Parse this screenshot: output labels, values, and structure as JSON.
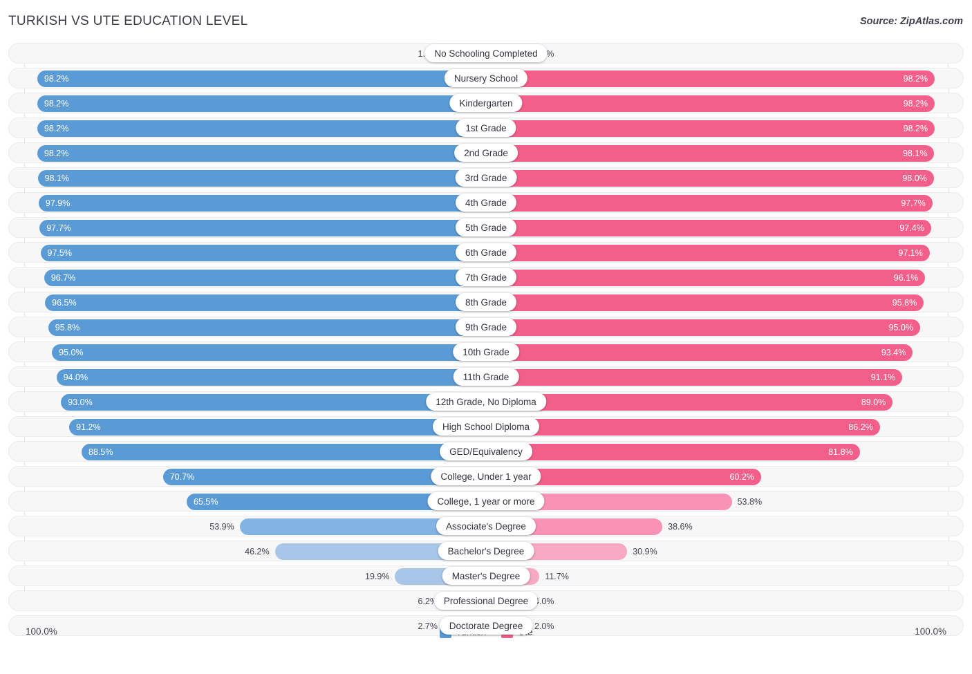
{
  "header": {
    "title": "TURKISH VS UTE EDUCATION LEVEL",
    "source": "Source: ZipAtlas.com"
  },
  "axis": {
    "left_max": "100.0%",
    "right_max": "100.0%"
  },
  "legend": {
    "items": [
      {
        "label": "Turkish",
        "color": "#5b9bd5"
      },
      {
        "label": "Ute",
        "color": "#f25f8a"
      }
    ]
  },
  "colors": {
    "blue_dark": "#5b9bd5",
    "blue_mid": "#82b3e3",
    "blue_light": "#a8c6e8",
    "pink_dark": "#f25f8a",
    "pink_mid": "#f893b5",
    "pink_light": "#f7a9c4",
    "row_bg": "#f7f7f8",
    "row_border": "#ebebee",
    "gridline": "#e3e3e7"
  },
  "chart_data": {
    "type": "bar",
    "title": "TURKISH VS UTE EDUCATION LEVEL",
    "subtitle": "Source: ZipAtlas.com",
    "orientation": "horizontal-diverging",
    "xlabel": "",
    "ylabel": "",
    "xlim": [
      0,
      100
    ],
    "grid": true,
    "legend_position": "bottom-center",
    "axis_labels": {
      "left": "100.0%",
      "right": "100.0%"
    },
    "series": [
      {
        "name": "Turkish",
        "color": "#5b9bd5",
        "side": "left"
      },
      {
        "name": "Ute",
        "color": "#f25f8a",
        "side": "right"
      }
    ],
    "categories": [
      "No Schooling Completed",
      "Nursery School",
      "Kindergarten",
      "1st Grade",
      "2nd Grade",
      "3rd Grade",
      "4th Grade",
      "5th Grade",
      "6th Grade",
      "7th Grade",
      "8th Grade",
      "9th Grade",
      "10th Grade",
      "11th Grade",
      "12th Grade, No Diploma",
      "High School Diploma",
      "GED/Equivalency",
      "College, Under 1 year",
      "College, 1 year or more",
      "Associate's Degree",
      "Bachelor's Degree",
      "Master's Degree",
      "Professional Degree",
      "Doctorate Degree"
    ],
    "turkish_values": [
      1.8,
      98.2,
      98.2,
      98.2,
      98.2,
      98.1,
      97.9,
      97.7,
      97.5,
      96.7,
      96.5,
      95.8,
      95.0,
      94.0,
      93.0,
      91.2,
      88.5,
      70.7,
      65.5,
      53.9,
      46.2,
      19.9,
      6.2,
      2.7
    ],
    "ute_values": [
      2.3,
      98.2,
      98.2,
      98.2,
      98.1,
      98.0,
      97.7,
      97.4,
      97.1,
      96.1,
      95.8,
      95.0,
      93.4,
      91.1,
      89.0,
      86.2,
      81.8,
      60.2,
      53.8,
      38.6,
      30.9,
      11.7,
      4.0,
      2.0
    ]
  },
  "rows": [
    {
      "label": "No Schooling Completed",
      "left": {
        "text": "1.8%",
        "value": 1.8,
        "tone": "light",
        "inside": false
      },
      "right": {
        "text": "2.3%",
        "value": 2.3,
        "tone": "light",
        "inside": false
      }
    },
    {
      "label": "Nursery School",
      "left": {
        "text": "98.2%",
        "value": 98.2,
        "tone": "dark",
        "inside": true
      },
      "right": {
        "text": "98.2%",
        "value": 98.2,
        "tone": "dark",
        "inside": true
      }
    },
    {
      "label": "Kindergarten",
      "left": {
        "text": "98.2%",
        "value": 98.2,
        "tone": "dark",
        "inside": true
      },
      "right": {
        "text": "98.2%",
        "value": 98.2,
        "tone": "dark",
        "inside": true
      }
    },
    {
      "label": "1st Grade",
      "left": {
        "text": "98.2%",
        "value": 98.2,
        "tone": "dark",
        "inside": true
      },
      "right": {
        "text": "98.2%",
        "value": 98.2,
        "tone": "dark",
        "inside": true
      }
    },
    {
      "label": "2nd Grade",
      "left": {
        "text": "98.2%",
        "value": 98.2,
        "tone": "dark",
        "inside": true
      },
      "right": {
        "text": "98.1%",
        "value": 98.1,
        "tone": "dark",
        "inside": true
      }
    },
    {
      "label": "3rd Grade",
      "left": {
        "text": "98.1%",
        "value": 98.1,
        "tone": "dark",
        "inside": true
      },
      "right": {
        "text": "98.0%",
        "value": 98.0,
        "tone": "dark",
        "inside": true
      }
    },
    {
      "label": "4th Grade",
      "left": {
        "text": "97.9%",
        "value": 97.9,
        "tone": "dark",
        "inside": true
      },
      "right": {
        "text": "97.7%",
        "value": 97.7,
        "tone": "dark",
        "inside": true
      }
    },
    {
      "label": "5th Grade",
      "left": {
        "text": "97.7%",
        "value": 97.7,
        "tone": "dark",
        "inside": true
      },
      "right": {
        "text": "97.4%",
        "value": 97.4,
        "tone": "dark",
        "inside": true
      }
    },
    {
      "label": "6th Grade",
      "left": {
        "text": "97.5%",
        "value": 97.5,
        "tone": "dark",
        "inside": true
      },
      "right": {
        "text": "97.1%",
        "value": 97.1,
        "tone": "dark",
        "inside": true
      }
    },
    {
      "label": "7th Grade",
      "left": {
        "text": "96.7%",
        "value": 96.7,
        "tone": "dark",
        "inside": true
      },
      "right": {
        "text": "96.1%",
        "value": 96.1,
        "tone": "dark",
        "inside": true
      }
    },
    {
      "label": "8th Grade",
      "left": {
        "text": "96.5%",
        "value": 96.5,
        "tone": "dark",
        "inside": true
      },
      "right": {
        "text": "95.8%",
        "value": 95.8,
        "tone": "dark",
        "inside": true
      }
    },
    {
      "label": "9th Grade",
      "left": {
        "text": "95.8%",
        "value": 95.8,
        "tone": "dark",
        "inside": true
      },
      "right": {
        "text": "95.0%",
        "value": 95.0,
        "tone": "dark",
        "inside": true
      }
    },
    {
      "label": "10th Grade",
      "left": {
        "text": "95.0%",
        "value": 95.0,
        "tone": "dark",
        "inside": true
      },
      "right": {
        "text": "93.4%",
        "value": 93.4,
        "tone": "dark",
        "inside": true
      }
    },
    {
      "label": "11th Grade",
      "left": {
        "text": "94.0%",
        "value": 94.0,
        "tone": "dark",
        "inside": true
      },
      "right": {
        "text": "91.1%",
        "value": 91.1,
        "tone": "dark",
        "inside": true
      }
    },
    {
      "label": "12th Grade, No Diploma",
      "left": {
        "text": "93.0%",
        "value": 93.0,
        "tone": "dark",
        "inside": true
      },
      "right": {
        "text": "89.0%",
        "value": 89.0,
        "tone": "dark",
        "inside": true
      }
    },
    {
      "label": "High School Diploma",
      "left": {
        "text": "91.2%",
        "value": 91.2,
        "tone": "dark",
        "inside": true
      },
      "right": {
        "text": "86.2%",
        "value": 86.2,
        "tone": "dark",
        "inside": true
      }
    },
    {
      "label": "GED/Equivalency",
      "left": {
        "text": "88.5%",
        "value": 88.5,
        "tone": "dark",
        "inside": true
      },
      "right": {
        "text": "81.8%",
        "value": 81.8,
        "tone": "dark",
        "inside": true
      }
    },
    {
      "label": "College, Under 1 year",
      "left": {
        "text": "70.7%",
        "value": 70.7,
        "tone": "dark",
        "inside": true
      },
      "right": {
        "text": "60.2%",
        "value": 60.2,
        "tone": "dark",
        "inside": true
      }
    },
    {
      "label": "College, 1 year or more",
      "left": {
        "text": "65.5%",
        "value": 65.5,
        "tone": "dark",
        "inside": true
      },
      "right": {
        "text": "53.8%",
        "value": 53.8,
        "tone": "mid",
        "inside": false
      }
    },
    {
      "label": "Associate's Degree",
      "left": {
        "text": "53.9%",
        "value": 53.9,
        "tone": "mid",
        "inside": false
      },
      "right": {
        "text": "38.6%",
        "value": 38.6,
        "tone": "mid",
        "inside": false
      }
    },
    {
      "label": "Bachelor's Degree",
      "left": {
        "text": "46.2%",
        "value": 46.2,
        "tone": "light",
        "inside": false
      },
      "right": {
        "text": "30.9%",
        "value": 30.9,
        "tone": "light",
        "inside": false
      }
    },
    {
      "label": "Master's Degree",
      "left": {
        "text": "19.9%",
        "value": 19.9,
        "tone": "light",
        "inside": false
      },
      "right": {
        "text": "11.7%",
        "value": 11.7,
        "tone": "light",
        "inside": false
      }
    },
    {
      "label": "Professional Degree",
      "left": {
        "text": "6.2%",
        "value": 6.2,
        "tone": "light",
        "inside": false
      },
      "right": {
        "text": "4.0%",
        "value": 4.0,
        "tone": "light",
        "inside": false
      }
    },
    {
      "label": "Doctorate Degree",
      "left": {
        "text": "2.7%",
        "value": 2.7,
        "tone": "light",
        "inside": false
      },
      "right": {
        "text": "2.0%",
        "value": 2.0,
        "tone": "light",
        "inside": false
      }
    }
  ]
}
